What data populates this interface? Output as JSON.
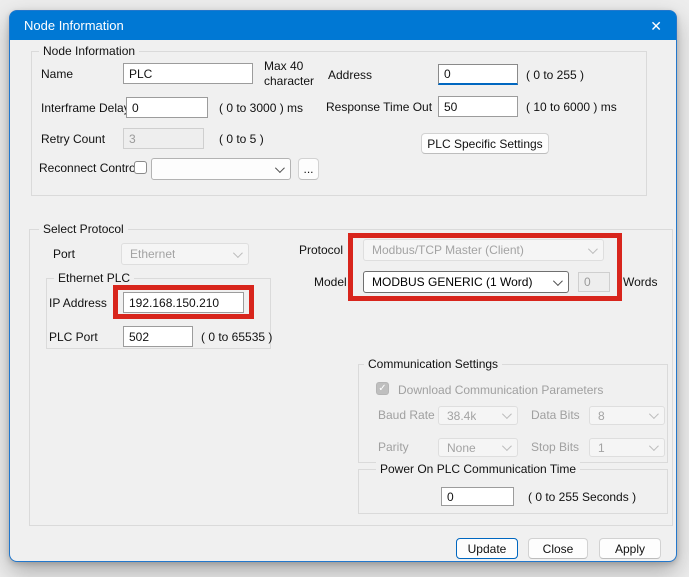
{
  "window": {
    "title": "Node Information",
    "close_icon": "✕"
  },
  "icons": {
    "check": "✓"
  },
  "node_info": {
    "title": "Node Information",
    "name_label": "Name",
    "name_value": "PLC",
    "name_hint": "Max 40 character",
    "address_label": "Address",
    "address_value": "0",
    "address_hint": "( 0 to 255 )",
    "interframe_label": "Interframe Delay",
    "interframe_value": "0",
    "interframe_hint": "( 0 to 3000 ) ms",
    "response_label": "Response Time Out",
    "response_value": "50",
    "response_hint": "( 10 to 6000 ) ms",
    "retry_label": "Retry Count",
    "retry_value": "3",
    "retry_hint": "( 0 to 5 )",
    "plc_settings_button": "PLC Specific Settings",
    "reconnect_label": "Reconnect Control",
    "reconnect_dropdown_value": "",
    "more_button": "..."
  },
  "select_protocol": {
    "title": "Select Protocol",
    "port_label": "Port",
    "port_value": "Ethernet",
    "protocol_label": "Protocol",
    "protocol_value": "Modbus/TCP Master (Client)",
    "model_label": "Model",
    "model_value": "MODBUS GENERIC (1 Word)",
    "words_value": "0",
    "words_label": "Words",
    "ethernet": {
      "title": "Ethernet PLC",
      "ip_label": "IP Address",
      "ip_value": "192.168.150.210",
      "plc_port_label": "PLC Port",
      "plc_port_value": "502",
      "plc_port_hint": "( 0 to 65535 )"
    }
  },
  "comm_settings": {
    "title": "Communication Settings",
    "download_label": "Download Communication Parameters",
    "baud_label": "Baud Rate",
    "baud_value": "38.4k",
    "data_bits_label": "Data Bits",
    "data_bits_value": "8",
    "parity_label": "Parity",
    "parity_value": "None",
    "stop_bits_label": "Stop Bits",
    "stop_bits_value": "1"
  },
  "power_on": {
    "title": "Power On PLC Communication Time",
    "value": "0",
    "hint": "( 0 to 255 Seconds )"
  },
  "footer": {
    "update": "Update",
    "close": "Close",
    "apply": "Apply"
  }
}
